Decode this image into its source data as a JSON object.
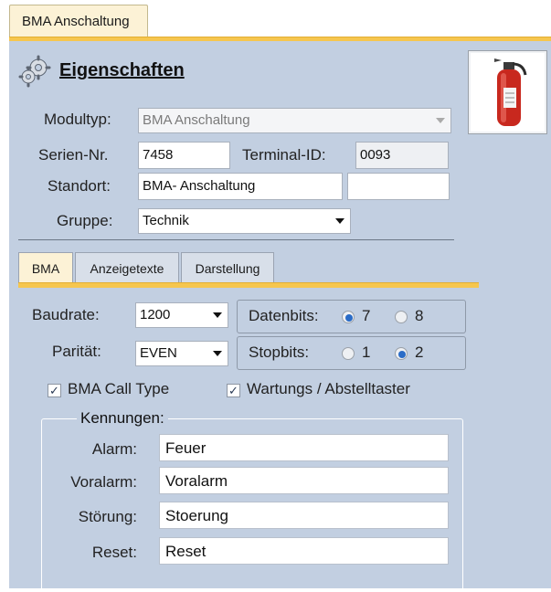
{
  "top_tab": {
    "label": "BMA Anschaltung"
  },
  "header": {
    "title": "Eigenschaften"
  },
  "form": {
    "modultyp": {
      "label": "Modultyp:",
      "value": "BMA Anschaltung"
    },
    "seriennr": {
      "label": "Serien-Nr.",
      "value": "7458"
    },
    "terminal": {
      "label": "Terminal-ID:",
      "value": "0093"
    },
    "standort": {
      "label": "Standort:",
      "value": "BMA- Anschaltung",
      "extra_value": ""
    },
    "gruppe": {
      "label": "Gruppe:",
      "value": "Technik"
    }
  },
  "tabs": [
    {
      "label": "BMA",
      "active": true
    },
    {
      "label": "Anzeigetexte",
      "active": false
    },
    {
      "label": "Darstellung",
      "active": false
    }
  ],
  "bma": {
    "baudrate": {
      "label": "Baudrate:",
      "value": "1200"
    },
    "paritaet": {
      "label": "Parität:",
      "value": "EVEN"
    },
    "datenbits": {
      "label": "Datenbits:",
      "options": [
        "7",
        "8"
      ],
      "selected": "7"
    },
    "stopbits": {
      "label": "Stopbits:",
      "options": [
        "1",
        "2"
      ],
      "selected": "2"
    },
    "call_type": {
      "label": "BMA Call Type",
      "checked": true
    },
    "wartung": {
      "label": "Wartungs / Abstelltaster",
      "checked": true
    }
  },
  "kennungen": {
    "legend": "Kennungen:",
    "rows": [
      {
        "label": "Alarm:",
        "value": "Feuer"
      },
      {
        "label": "Voralarm:",
        "value": "Voralarm"
      },
      {
        "label": "Störung:",
        "value": "Stoerung"
      },
      {
        "label": "Reset:",
        "value": "Reset"
      }
    ]
  },
  "icons": {
    "header": "gears-icon",
    "module": "fire-extinguisher-icon"
  },
  "colors": {
    "panel": "#c2cfe1",
    "accent": "#f6c64e",
    "radio_selected": "#2a6cc7"
  }
}
